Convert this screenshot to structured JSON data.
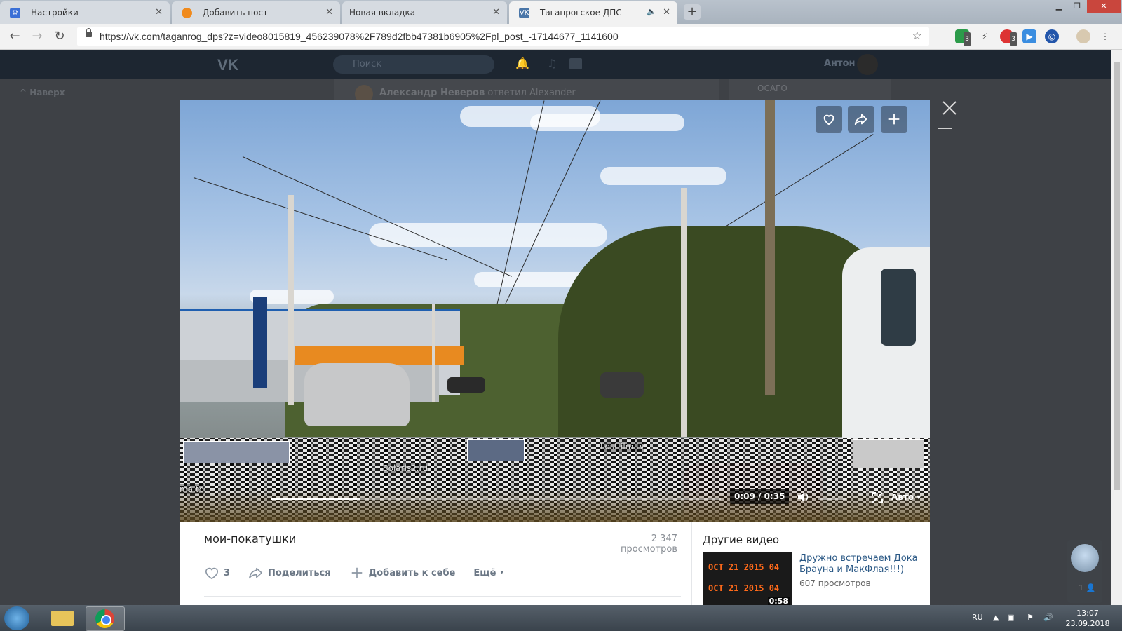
{
  "browser": {
    "tabs": [
      {
        "label": "Настройки",
        "icon": "gear-icon"
      },
      {
        "label": "Добавить пост",
        "icon": "orange-ball-icon"
      },
      {
        "label": "Новая вкладка",
        "icon": "none"
      },
      {
        "label": "Таганрогское ДПС",
        "icon": "vk-icon",
        "active": true
      }
    ],
    "url": "https://vk.com/taganrog_dps?z=video8015819_456239078%2F789d2fbb47381b6905%2Fpl_post_-17144677_1141600",
    "extension_badges": [
      "3",
      "3"
    ]
  },
  "vk": {
    "search_placeholder": "Поиск",
    "user_name": "Антон",
    "up_link": "Наверх",
    "feed_author": "Александр Неверов",
    "feed_action": "ответил Alexander",
    "side_item": "ОСАГО"
  },
  "video": {
    "title": "мои-покатушки",
    "views": "2 347 просмотров",
    "time": "0:09 / 0:35",
    "progress": 0.2,
    "quality": "Авто",
    "like_count": "3",
    "share_label": "Поделиться",
    "add_label": "Добавить к себе",
    "more_label": "Ещё",
    "glitch_texts": [
      "Lostfilm.tv",
      "Solaris2.ru",
      "ma.to"
    ]
  },
  "other_videos": {
    "heading": "Другие видео",
    "items": [
      {
        "title": "Дружно встречаем Дока Брауна и МакФлая!!!)",
        "views": "607 просмотров",
        "duration": "0:58",
        "thumb_lines": [
          "OCT 21 2015 04",
          "OCT 21 2015 04"
        ]
      }
    ]
  },
  "chat": {
    "count": "1"
  },
  "taskbar": {
    "language": "RU",
    "time": "13:07",
    "date": "23.09.2018"
  },
  "colors": {
    "vk_header": "#1d2631",
    "vk_link": "#2a5885",
    "overlay_bg": "#3e4146"
  }
}
